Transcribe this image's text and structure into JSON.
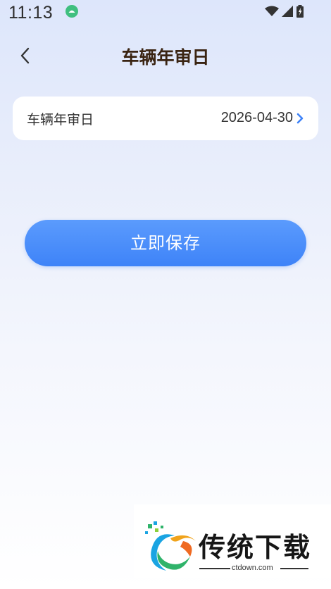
{
  "status_bar": {
    "time": "11:13",
    "icons": [
      "android-notification-icon",
      "wifi-icon",
      "signal-icon",
      "battery-icon"
    ]
  },
  "nav": {
    "back_icon": "chevron-left-icon",
    "title": "车辆年审日"
  },
  "card": {
    "label": "车辆年审日",
    "value": "2026-04-30",
    "chevron_icon": "chevron-right-icon",
    "chevron_color": "#3e83f8"
  },
  "save_button": {
    "label": "立即保存",
    "color": "#3e83f8"
  },
  "watermark": {
    "brand": "传统下载",
    "domain": "ctdown.com",
    "logo_icon": "ctdown-logo-icon"
  },
  "colors": {
    "title": "#3a2412",
    "accent": "#3e83f8",
    "background_top": "#dde6fb"
  }
}
